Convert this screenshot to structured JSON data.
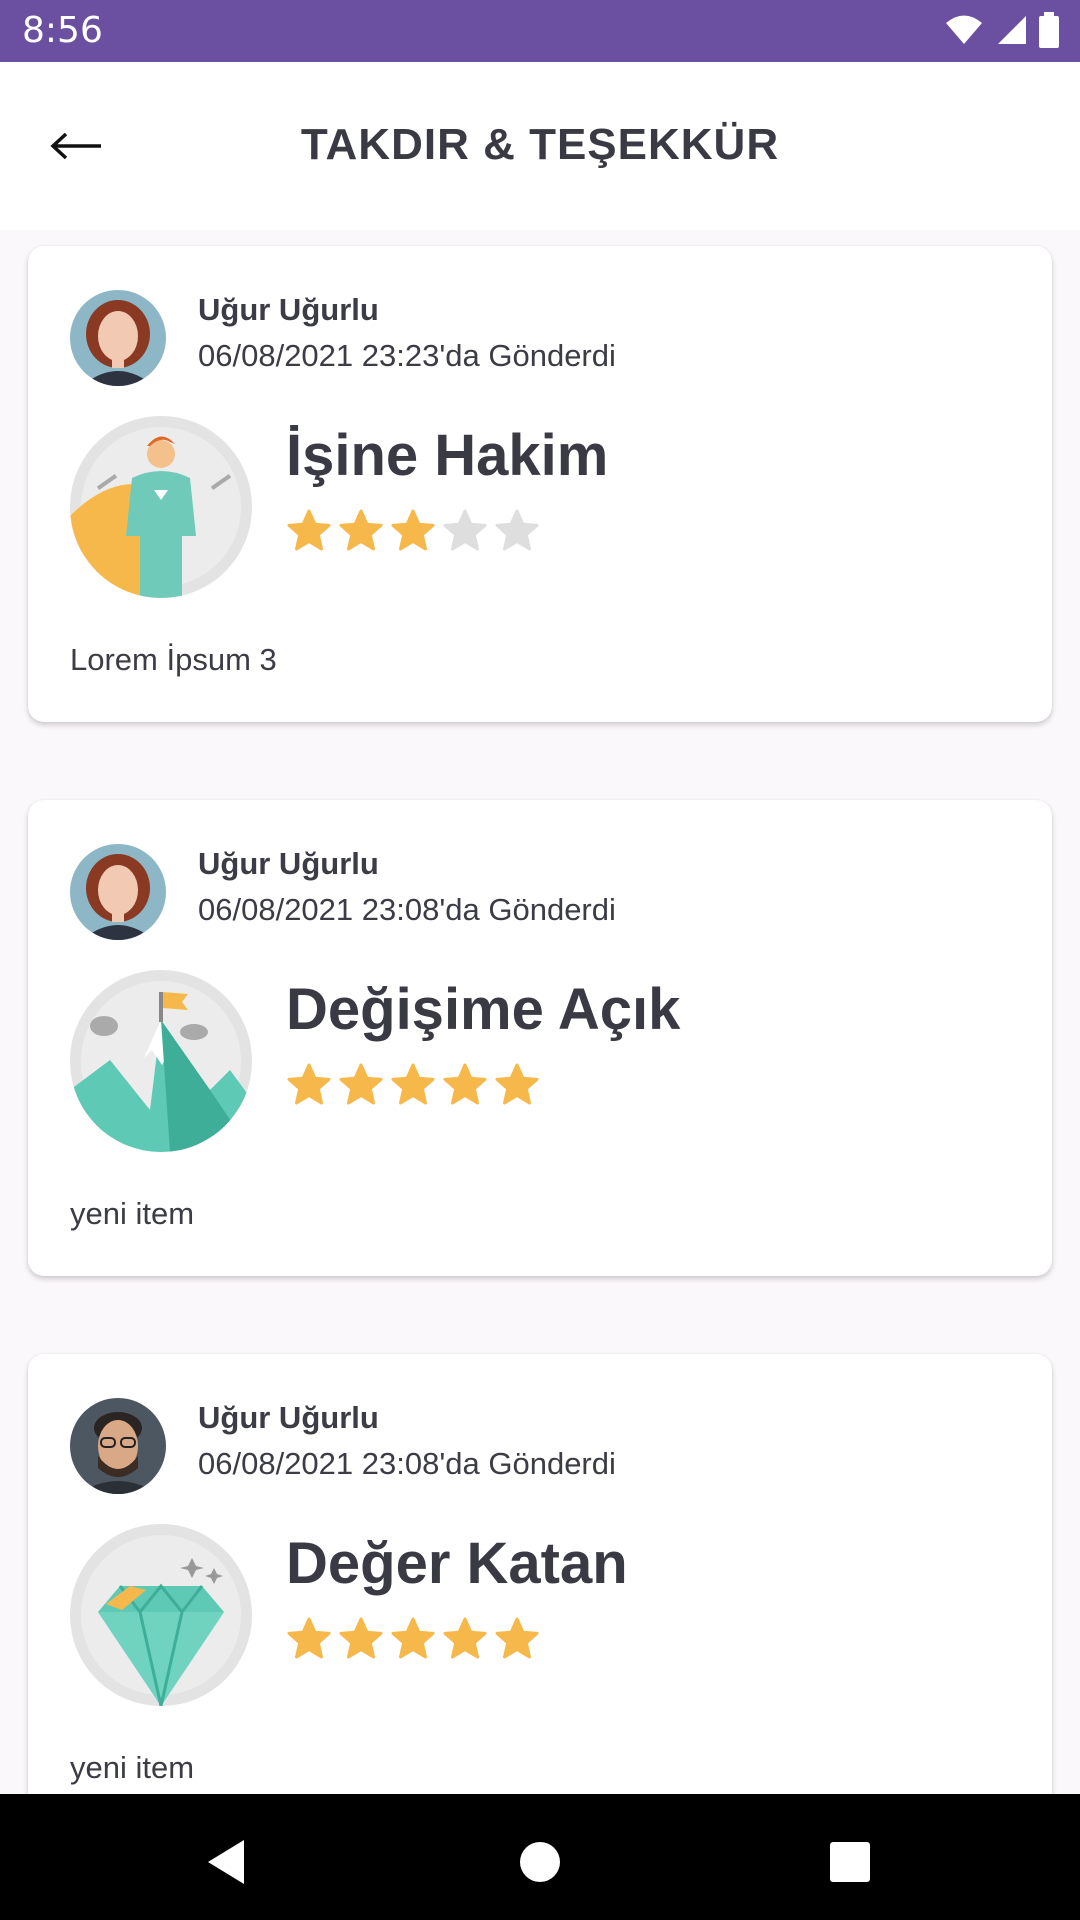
{
  "status_bar": {
    "time": "8:56",
    "icons": [
      "wifi-icon",
      "cell-signal-icon",
      "battery-icon"
    ]
  },
  "app_bar": {
    "back_icon": "arrow-left-icon",
    "title": "TAKDIR & TEŞEKKÜR"
  },
  "colors": {
    "status_bar": "#6b4fa1",
    "star_filled": "#f7b84b",
    "star_empty": "#dedede",
    "teal": "#5ec9b4",
    "text": "#3c3c46"
  },
  "cards": [
    {
      "sender": "Uğur Uğurlu",
      "date": "06/08/2021 23:23'da Gönderdi",
      "avatar": "woman-avatar",
      "badge_icon": "superhero-icon",
      "badge_title": "İşine Hakim",
      "rating": 3,
      "rating_max": 5,
      "message": "Lorem İpsum 3"
    },
    {
      "sender": "Uğur Uğurlu",
      "date": "06/08/2021 23:08'da Gönderdi",
      "avatar": "woman-avatar",
      "badge_icon": "mountain-flag-icon",
      "badge_title": "Değişime Açık",
      "rating": 5,
      "rating_max": 5,
      "message": "yeni item"
    },
    {
      "sender": "Uğur Uğurlu",
      "date": "06/08/2021 23:08'da Gönderdi",
      "avatar": "man-avatar",
      "badge_icon": "diamond-icon",
      "badge_title": "Değer Katan",
      "rating": 5,
      "rating_max": 5,
      "message": "yeni item"
    }
  ],
  "nav_bar": {
    "icons": [
      "back-triangle-icon",
      "home-circle-icon",
      "recents-square-icon"
    ]
  }
}
